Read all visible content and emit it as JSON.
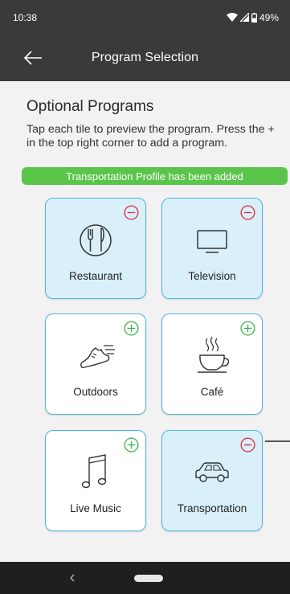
{
  "status_bar": {
    "time": "10:38",
    "battery": "49%"
  },
  "app_bar": {
    "title": "Program Selection"
  },
  "section": {
    "title": "Optional Programs",
    "description": "Tap each tile to preview the program. Press the + in the top right corner to add a program."
  },
  "banner": {
    "text": "Transportation Profile has been added",
    "color": "#5ac54a"
  },
  "colors": {
    "tile_border": "#4cb6de",
    "selected_bg": "#d9f0fb",
    "add": "#3cb64a",
    "remove": "#e02b3c"
  },
  "tiles": [
    {
      "label": "Restaurant",
      "icon": "restaurant-icon",
      "selected": true,
      "toggle": "remove-icon"
    },
    {
      "label": "Television",
      "icon": "television-icon",
      "selected": true,
      "toggle": "remove-icon"
    },
    {
      "label": "Outdoors",
      "icon": "running-shoe-icon",
      "selected": false,
      "toggle": "add-icon"
    },
    {
      "label": "Café",
      "icon": "coffee-cup-icon",
      "selected": false,
      "toggle": "add-icon"
    },
    {
      "label": "Live Music",
      "icon": "music-note-icon",
      "selected": false,
      "toggle": "add-icon"
    },
    {
      "label": "Transportation",
      "icon": "car-icon",
      "selected": true,
      "toggle": "remove-icon"
    }
  ]
}
